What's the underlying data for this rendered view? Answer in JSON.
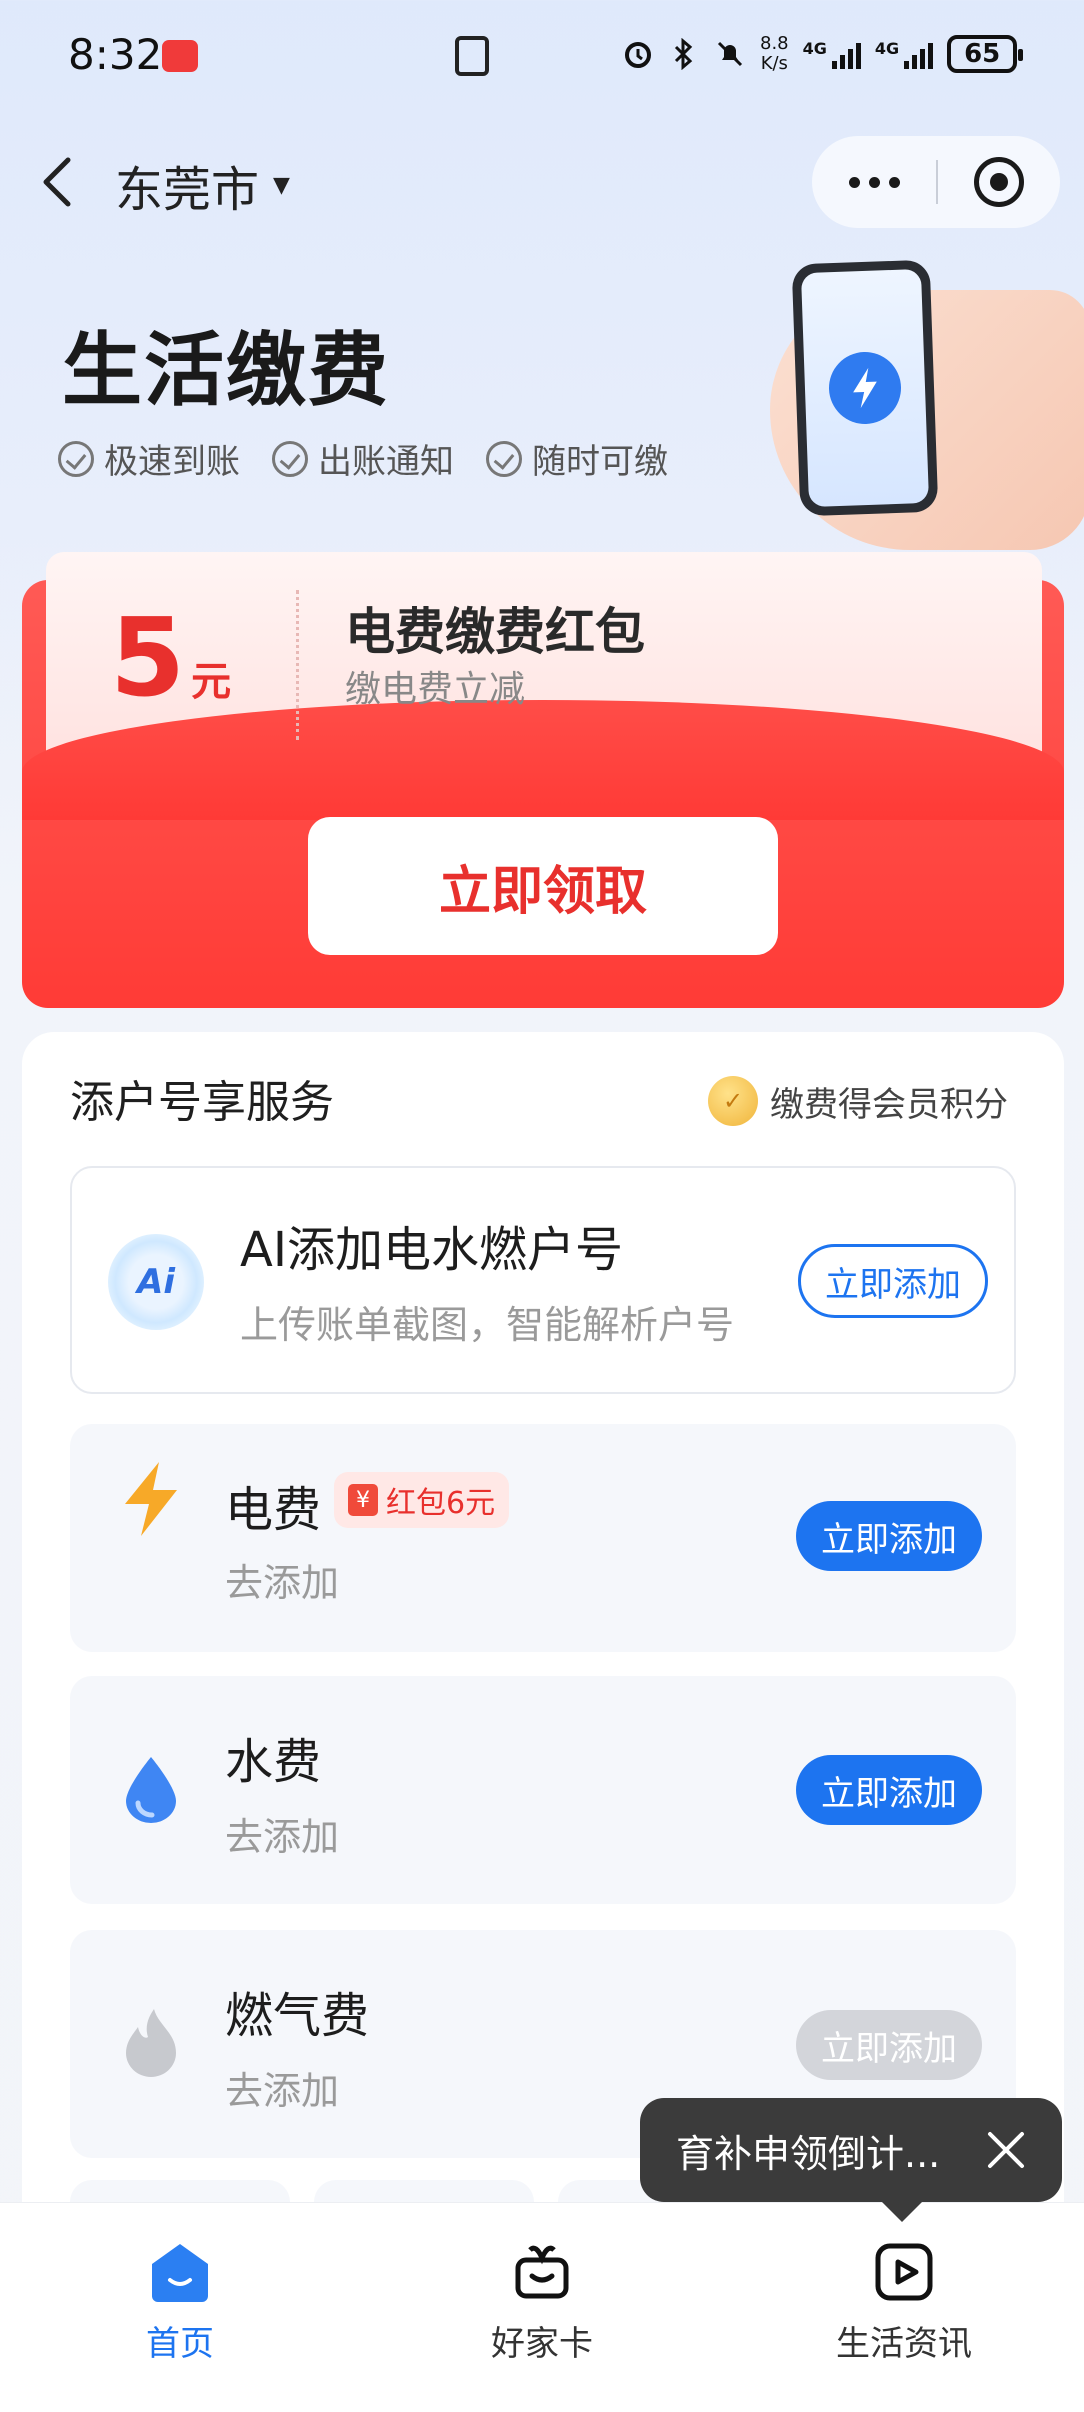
{
  "status_bar": {
    "time": "8:32",
    "net_speed_value": "8.8",
    "net_speed_unit": "K/s",
    "network_1": "4G",
    "network_2": "4G",
    "battery": "65"
  },
  "nav": {
    "city": "东莞市"
  },
  "header": {
    "title": "生活缴费",
    "features": [
      "极速到账",
      "出账通知",
      "随时可缴"
    ]
  },
  "promo": {
    "amount": "5",
    "unit": "元",
    "title": "电费缴费红包",
    "subtitle": "缴电费立减",
    "claim_label": "立即领取"
  },
  "services": {
    "title": "添户号享服务",
    "points_label": "缴费得会员积分",
    "ai": {
      "icon_text": "Ai",
      "title": "AI添加电水燃户号",
      "subtitle": "上传账单截图，智能解析户号",
      "button": "立即添加"
    },
    "items": [
      {
        "name": "电费",
        "sub": "去添加",
        "button": "立即添加",
        "badge": "红包6元",
        "badge_icon": "¥",
        "icon": "lightning-icon",
        "enabled": true
      },
      {
        "name": "水费",
        "sub": "去添加",
        "button": "立即添加",
        "icon": "water-drop-icon",
        "enabled": true
      },
      {
        "name": "燃气费",
        "sub": "去添加",
        "button": "立即添加",
        "icon": "flame-icon",
        "enabled": false
      }
    ]
  },
  "toast": {
    "text": "育补申领倒计..."
  },
  "tabbar": {
    "tabs": [
      {
        "label": "首页",
        "icon": "home-icon",
        "active": true
      },
      {
        "label": "好家卡",
        "icon": "gift-icon",
        "active": false
      },
      {
        "label": "生活资讯",
        "icon": "video-play-icon",
        "active": false
      }
    ]
  },
  "colors": {
    "accent": "#1d74f0",
    "promo_red": "#ff3b36",
    "promo_text": "#e8302d"
  }
}
